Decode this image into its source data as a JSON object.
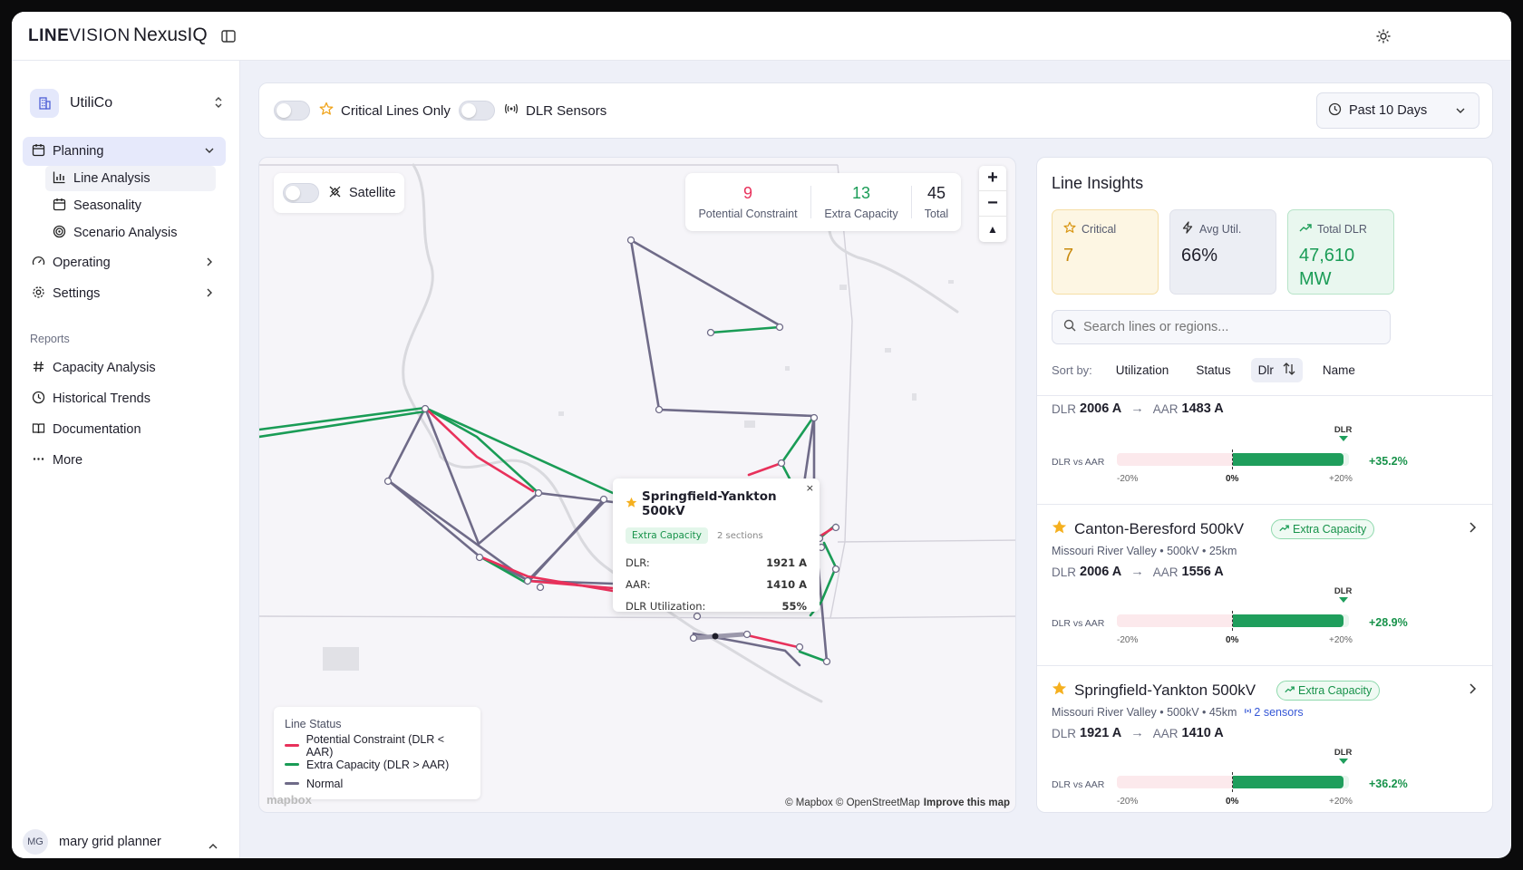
{
  "brand": {
    "logo_bold": "LINE",
    "logo_light": "VISION",
    "product": "NexusIQ"
  },
  "org": {
    "name": "UtiliCo"
  },
  "nav": {
    "planning": "Planning",
    "line_analysis": "Line Analysis",
    "seasonality": "Seasonality",
    "scenario_analysis": "Scenario Analysis",
    "operating": "Operating",
    "settings": "Settings",
    "reports_label": "Reports",
    "capacity_analysis": "Capacity Analysis",
    "historical_trends": "Historical Trends",
    "documentation": "Documentation",
    "more": "More"
  },
  "user": {
    "initials": "MG",
    "name": "mary grid planner"
  },
  "filters": {
    "critical_only": "Critical Lines Only",
    "dlr_sensors": "DLR Sensors",
    "period": "Past 10 Days"
  },
  "map": {
    "satellite": "Satellite",
    "stats": [
      {
        "value": "9",
        "label": "Potential Constraint",
        "color": "#e8315b"
      },
      {
        "value": "13",
        "label": "Extra Capacity",
        "color": "#1a9c56"
      },
      {
        "value": "45",
        "label": "Total",
        "color": "#1e1e2a"
      }
    ],
    "legend": {
      "title": "Line Status",
      "items": [
        {
          "label": "Potential Constraint (DLR < AAR)",
          "color": "#e8315b"
        },
        {
          "label": "Extra Capacity (DLR > AAR)",
          "color": "#1a9c56"
        },
        {
          "label": "Normal",
          "color": "#6f6b88"
        }
      ]
    },
    "attribution": "© Mapbox © OpenStreetMap",
    "improve": "Improve this map",
    "mapbox_logo": "mapbox",
    "tooltip": {
      "title": "Springfield-Yankton 500kV",
      "badge": "Extra Capacity",
      "sections": "2 sections",
      "close": "×",
      "rows": [
        {
          "label": "DLR:",
          "value": "1921 A"
        },
        {
          "label": "AAR:",
          "value": "1410 A"
        },
        {
          "label": "DLR Utilization:",
          "value": "55%"
        }
      ]
    }
  },
  "insights": {
    "title": "Line Insights",
    "kpis": {
      "critical": {
        "label": "Critical",
        "value": "7"
      },
      "avg_util": {
        "label": "Avg Util.",
        "value": "66%"
      },
      "total_dlr": {
        "label": "Total DLR",
        "value_line1": "47,610",
        "value_line2": "MW"
      }
    },
    "search_placeholder": "Search lines or regions...",
    "sort": {
      "label": "Sort by:",
      "options": [
        "Utilization",
        "Status",
        "Dlr",
        "Name"
      ],
      "active": "Dlr"
    },
    "bar_labels": {
      "row": "DLR vs AAR",
      "neg": "-20%",
      "zero": "0%",
      "pos": "+20%",
      "marker": "DLR"
    },
    "cards": [
      {
        "dlr_key": "DLR",
        "dlr": "2006 A",
        "aar_key": "AAR",
        "aar": "1483 A",
        "pct": "+35.2%",
        "fill": 0.95
      },
      {
        "name": "Canton-Beresford 500kV",
        "badge": "Extra Capacity",
        "meta": "Missouri River Valley • 500kV • 25km",
        "dlr_key": "DLR",
        "dlr": "2006 A",
        "aar_key": "AAR",
        "aar": "1556 A",
        "pct": "+28.9%",
        "fill": 0.95
      },
      {
        "name": "Springfield-Yankton 500kV",
        "badge": "Extra Capacity",
        "meta": "Missouri River Valley • 500kV • 45km",
        "sensors": "2 sensors",
        "dlr_key": "DLR",
        "dlr": "1921 A",
        "aar_key": "AAR",
        "aar": "1410 A",
        "pct": "+36.2%",
        "fill": 0.95
      }
    ]
  }
}
